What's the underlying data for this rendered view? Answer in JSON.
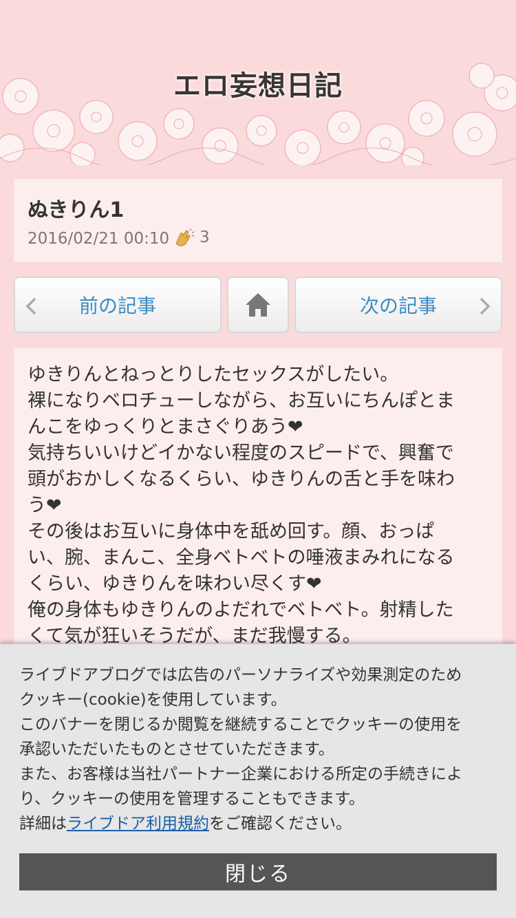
{
  "header": {
    "blog_title": "エロ妄想日記"
  },
  "article": {
    "title": "ぬきりん1",
    "date": "2016/02/21 00:10",
    "clap_count": "3"
  },
  "nav": {
    "prev_label": "前の記事",
    "next_label": "次の記事"
  },
  "body_lines": [
    "ゆきりんとねっとりしたセックスがしたい。",
    "裸になりベロチューしながら、お互いにちんぽとま",
    "んこをゆっくりとまさぐりあう❤",
    "気持ちいいけどイかない程度のスピードで、興奮で",
    "頭がおかしくなるくらい、ゆきりんの舌と手を味わ",
    "う❤",
    "その後はお互いに身体中を舐め回す。顔、おっぱ",
    "い、腕、まんこ、全身ベトベトの唾液まみれになる",
    "くらい、ゆきりんを味わい尽くす❤",
    "俺の身体もゆきりんのよだれでベトベト。射精した",
    "くて気が狂いそうだが、まだ我慢する。"
  ],
  "cookie_banner": {
    "line1": "ライブドアブログでは広告のパーソナライズや効果測定のため",
    "line2": "クッキー(cookie)を使用しています。",
    "line3": "このバナーを閉じるか閲覧を継続することでクッキーの使用を",
    "line4": "承認いただいたものとさせていただきます。",
    "line5": "また、お客様は当社パートナー企業における所定の手続きによ",
    "line6": "り、クッキーの使用を管理することもできます。",
    "line7_prefix": "詳細は",
    "line7_link": "ライブドア利用規約",
    "line7_suffix": "をご確認ください。",
    "close_label": "閉じる"
  },
  "colors": {
    "page_background": "#fbdadb",
    "card_background": "#fdeeee",
    "nav_link": "#3a8cc1",
    "banner_background": "#e6e6e6",
    "close_button": "#555555"
  },
  "icons": {
    "prev": "chevron-left-icon",
    "home": "home-icon",
    "next": "chevron-right-icon",
    "clap": "clap-icon"
  }
}
